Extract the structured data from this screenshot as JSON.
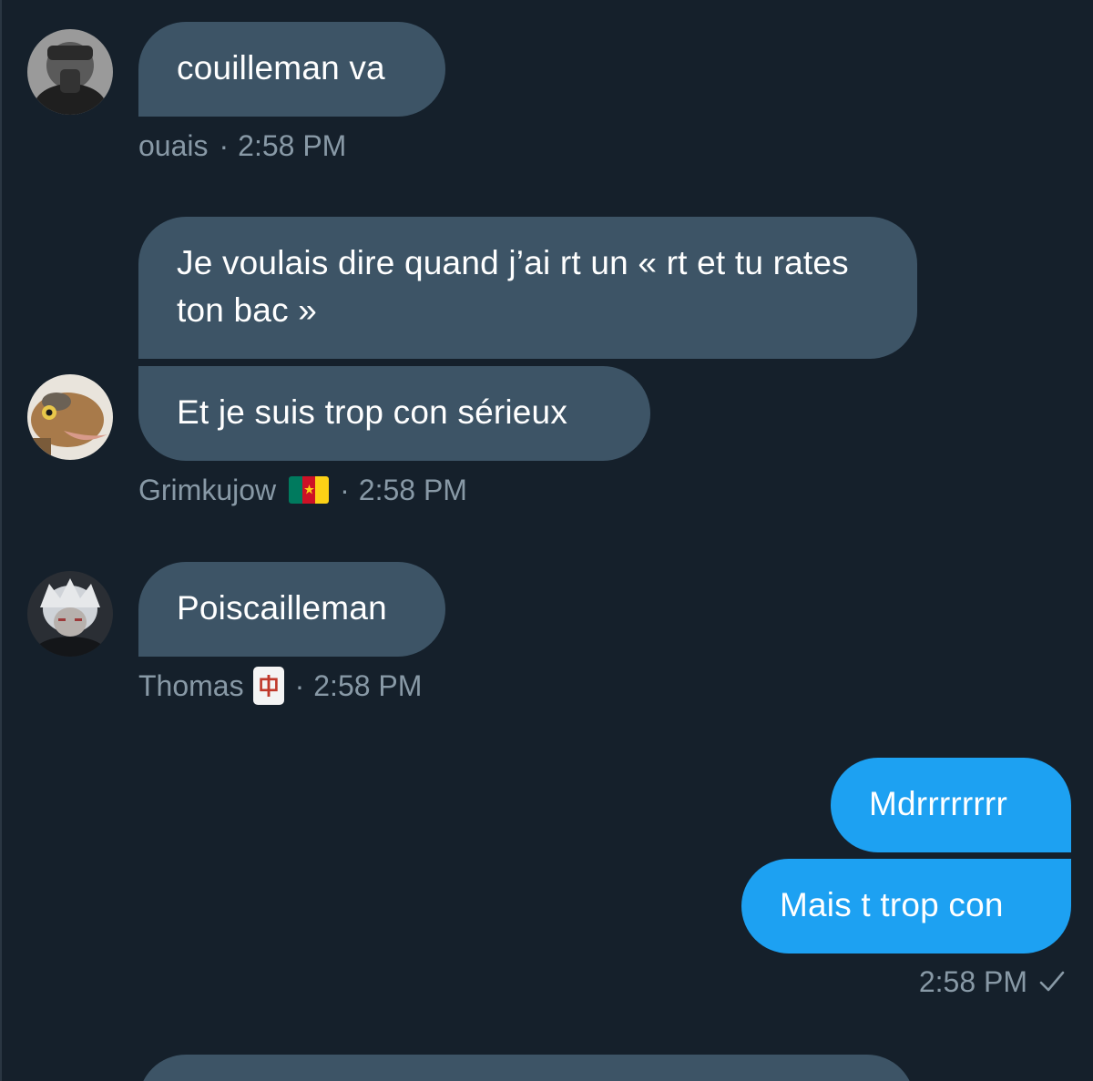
{
  "conversation": {
    "groups": [
      {
        "direction": "in",
        "avatar": "avatar-dark-photo",
        "messages": [
          "couilleman va"
        ],
        "sender": "ouais",
        "sender_emoji": null,
        "time": "2:58 PM"
      },
      {
        "direction": "in",
        "avatar": "avatar-frog-photo",
        "messages": [
          "Je voulais dire quand j’ai rt un « rt et tu rates ton bac »",
          "Et je suis trop con sérieux"
        ],
        "sender": "Grimkujow",
        "sender_emoji": "flag-cameroon-icon",
        "time": "2:58 PM"
      },
      {
        "direction": "in",
        "avatar": "avatar-white-hair-photo",
        "messages": [
          "Poiscailleman"
        ],
        "sender": "Thomas",
        "sender_emoji": "mahjong-red-dragon-icon",
        "time": "2:58 PM"
      },
      {
        "direction": "out",
        "messages": [
          "Mdrrrrrrrr",
          "Mais t trop con"
        ],
        "time": "2:58 PM",
        "status_icon": "checkmark-icon"
      }
    ],
    "colors": {
      "background": "#15202b",
      "incoming_bubble": "#3d5466",
      "outgoing_bubble": "#1da1f2",
      "meta_text": "#8899a6",
      "message_text": "#ffffff"
    }
  }
}
